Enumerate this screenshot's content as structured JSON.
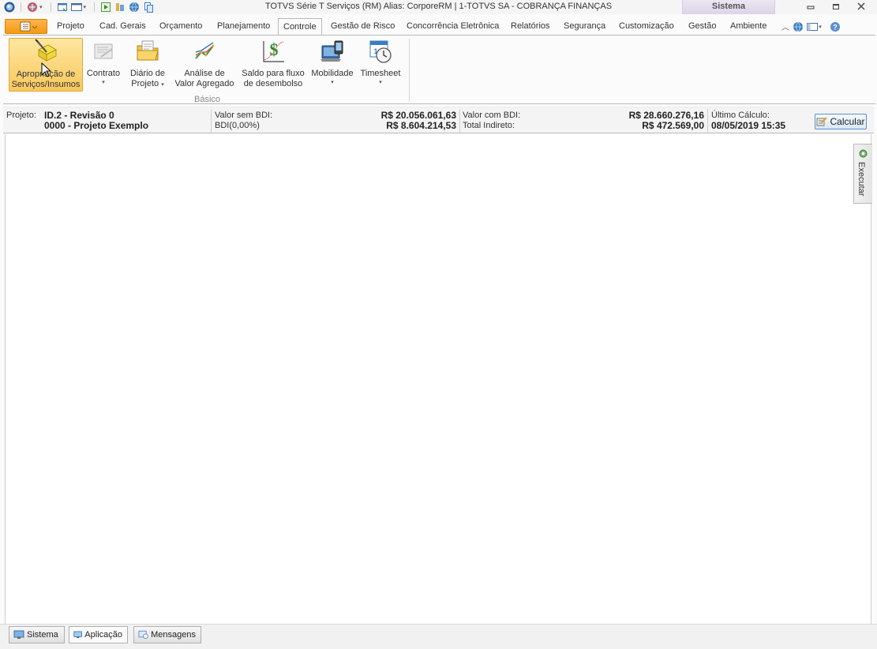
{
  "window": {
    "title": "TOTVS Série T Serviços (RM) Alias: CorporeRM | 1-TOTVS SA - COBRANÇA FINANÇAS",
    "context_tab": "Sistema",
    "controls": [
      "minimize",
      "restore",
      "close"
    ]
  },
  "quick_access": [
    "app-orb-icon",
    "globe-icon",
    "new-window-icon",
    "layout-icon",
    "run-icon",
    "tools-icon",
    "web-icon",
    "copy-icon"
  ],
  "tabs": [
    {
      "label": "Projeto"
    },
    {
      "label": "Cad. Gerais"
    },
    {
      "label": "Orçamento"
    },
    {
      "label": "Planejamento"
    },
    {
      "label": "Controle",
      "active": true
    },
    {
      "label": "Gestão de Risco"
    },
    {
      "label": "Concorrência Eletrônica"
    },
    {
      "label": "Relatórios"
    },
    {
      "label": "Segurança"
    },
    {
      "label": "Customização"
    },
    {
      "label": "Gestão"
    },
    {
      "label": "Ambiente"
    }
  ],
  "ribbon": {
    "group_label": "Básico",
    "buttons": [
      {
        "line1": "Apropriação de",
        "line2": "Serviços/Insumos",
        "icon": "pencil-box-icon",
        "active": true
      },
      {
        "line1": "Contrato",
        "line2": "",
        "icon": "contract-icon",
        "dropdown": true
      },
      {
        "line1": "Diário de",
        "line2": "Projeto",
        "icon": "folder-icon",
        "dropdown": true
      },
      {
        "line1": "Análise de",
        "line2": "Valor Agregado",
        "icon": "chart-icon"
      },
      {
        "line1": "Saldo para fluxo",
        "line2": "de desembolso",
        "icon": "dollar-chart-icon"
      },
      {
        "line1": "Mobilidade",
        "line2": "",
        "icon": "mobile-icon",
        "dropdown": true
      },
      {
        "line1": "Timesheet",
        "line2": "",
        "icon": "clock-calendar-icon",
        "dropdown": true
      }
    ]
  },
  "project": {
    "label": "Projeto:",
    "id": "ID.2 - Revisão 0",
    "name": "0000 - Projeto Exemplo",
    "valor_sem_bdi_label": "Valor sem BDI:",
    "valor_sem_bdi": "R$ 20.056.061,63",
    "bdi_label": "BDI(0,00%)",
    "bdi_value": "R$ 8.604.214,53",
    "valor_com_bdi_label": "Valor com BDI:",
    "valor_com_bdi": "R$ 28.660.276,16",
    "total_indireto_label": "Total Indireto:",
    "total_indireto": "R$ 472.569,00",
    "ultimo_calculo_label": "Último Cálculo:",
    "ultimo_calculo": "08/05/2019 15:35",
    "calc_button": "Calcular"
  },
  "side_panel": {
    "label": "Executar"
  },
  "bottom_tabs": [
    {
      "label": "Sistema",
      "icon": "monitor-icon"
    },
    {
      "label": "Aplicação",
      "icon": "app-icon"
    },
    {
      "label": "Mensagens",
      "icon": "messages-icon"
    }
  ],
  "colors": {
    "accent": "#f39a16",
    "ribbon_active": "#f9c85c",
    "button_border": "#5b8fcc"
  }
}
